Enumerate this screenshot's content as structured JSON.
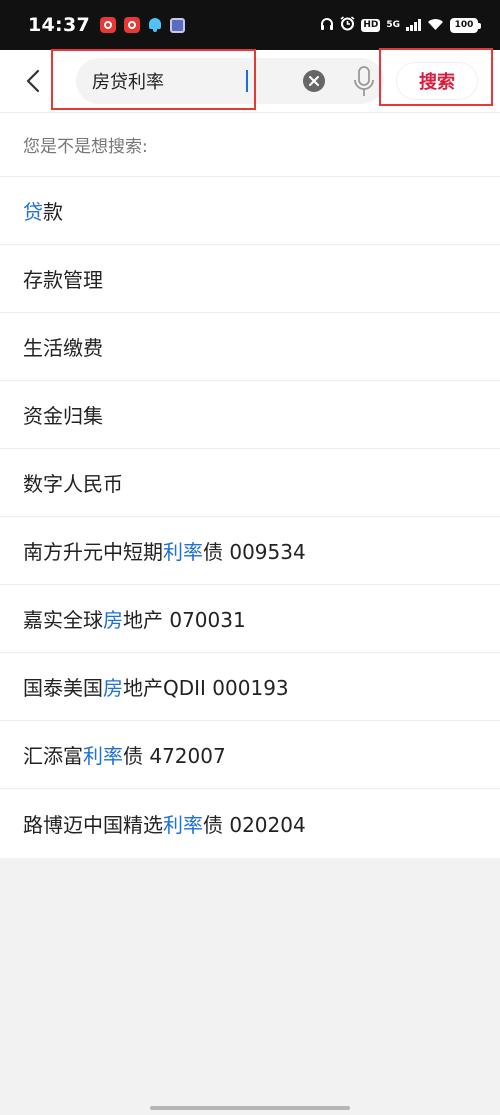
{
  "status_bar": {
    "time": "14:37",
    "network": "5G",
    "hd": "HD",
    "battery": "100"
  },
  "search": {
    "query": "房贷利率",
    "submit_label": "搜索",
    "accent_color": "#d81e3e"
  },
  "suggestions": {
    "hint": "您是不是想搜索:",
    "highlight_color": "#1e6fd9",
    "items": [
      {
        "parts": [
          {
            "text": "贷",
            "hl": true
          },
          {
            "text": "款",
            "hl": false
          }
        ]
      },
      {
        "parts": [
          {
            "text": "存款管理",
            "hl": false
          }
        ]
      },
      {
        "parts": [
          {
            "text": "生活缴费",
            "hl": false
          }
        ]
      },
      {
        "parts": [
          {
            "text": "资金归集",
            "hl": false
          }
        ]
      },
      {
        "parts": [
          {
            "text": "数字人民币",
            "hl": false
          }
        ]
      },
      {
        "parts": [
          {
            "text": "南方升元中短期",
            "hl": false
          },
          {
            "text": "利率",
            "hl": true
          },
          {
            "text": "债 009534",
            "hl": false
          }
        ]
      },
      {
        "parts": [
          {
            "text": "嘉实全球",
            "hl": false
          },
          {
            "text": "房",
            "hl": true
          },
          {
            "text": "地产 070031",
            "hl": false
          }
        ]
      },
      {
        "parts": [
          {
            "text": "国泰美国",
            "hl": false
          },
          {
            "text": "房",
            "hl": true
          },
          {
            "text": "地产QDII 000193",
            "hl": false
          }
        ]
      },
      {
        "parts": [
          {
            "text": "汇添富",
            "hl": false
          },
          {
            "text": "利率",
            "hl": true
          },
          {
            "text": "债 472007",
            "hl": false
          }
        ]
      },
      {
        "parts": [
          {
            "text": "路博迈中国精选",
            "hl": false
          },
          {
            "text": "利率",
            "hl": true
          },
          {
            "text": "债 020204",
            "hl": false
          }
        ]
      }
    ]
  }
}
